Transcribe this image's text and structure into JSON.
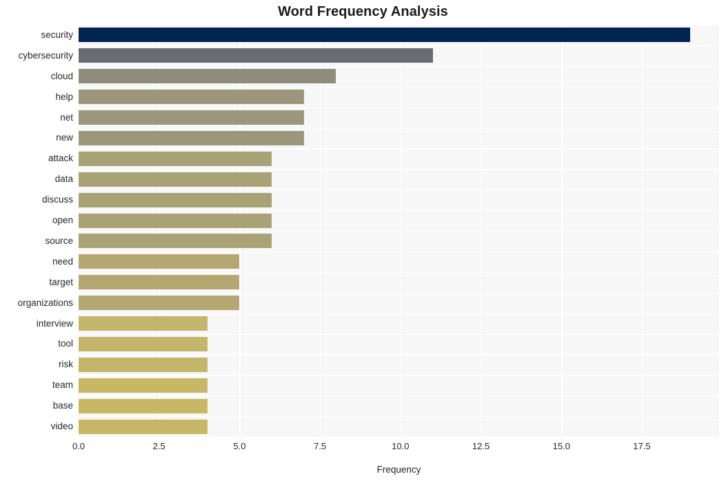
{
  "chart_data": {
    "type": "bar",
    "orientation": "horizontal",
    "title": "Word Frequency Analysis",
    "xlabel": "Frequency",
    "ylabel": "",
    "xlim": [
      0,
      19.9
    ],
    "ylim": [
      0,
      20
    ],
    "grid": true,
    "legend": false,
    "xticks": [
      "0.0",
      "2.5",
      "5.0",
      "7.5",
      "10.0",
      "12.5",
      "15.0",
      "17.5"
    ],
    "xtick_values": [
      0,
      2.5,
      5,
      7.5,
      10,
      12.5,
      15,
      17.5
    ],
    "categories": [
      "security",
      "cybersecurity",
      "cloud",
      "help",
      "net",
      "new",
      "attack",
      "data",
      "discuss",
      "open",
      "source",
      "need",
      "target",
      "organizations",
      "interview",
      "tool",
      "risk",
      "team",
      "base",
      "video"
    ],
    "values": [
      19,
      11,
      8,
      7,
      7,
      7,
      6,
      6,
      6,
      6,
      6,
      5,
      5,
      5,
      4,
      4,
      4,
      4,
      4,
      4
    ],
    "bar_colors": [
      "#00234f",
      "#6b6c72",
      "#8e8d7c",
      "#9b977c",
      "#9b977c",
      "#9b977c",
      "#a9a274",
      "#a9a274",
      "#a9a274",
      "#a9a274",
      "#a9a274",
      "#b3a871",
      "#b3a871",
      "#b3a871",
      "#c3b56a",
      "#c3b56a",
      "#c3b56a",
      "#c8b866",
      "#c8b866",
      "#c8b866"
    ],
    "plot_background": "#f7f7f7",
    "grid_color": "#ffffff",
    "figure_background": "#ffffff",
    "text_color": "#262626"
  }
}
